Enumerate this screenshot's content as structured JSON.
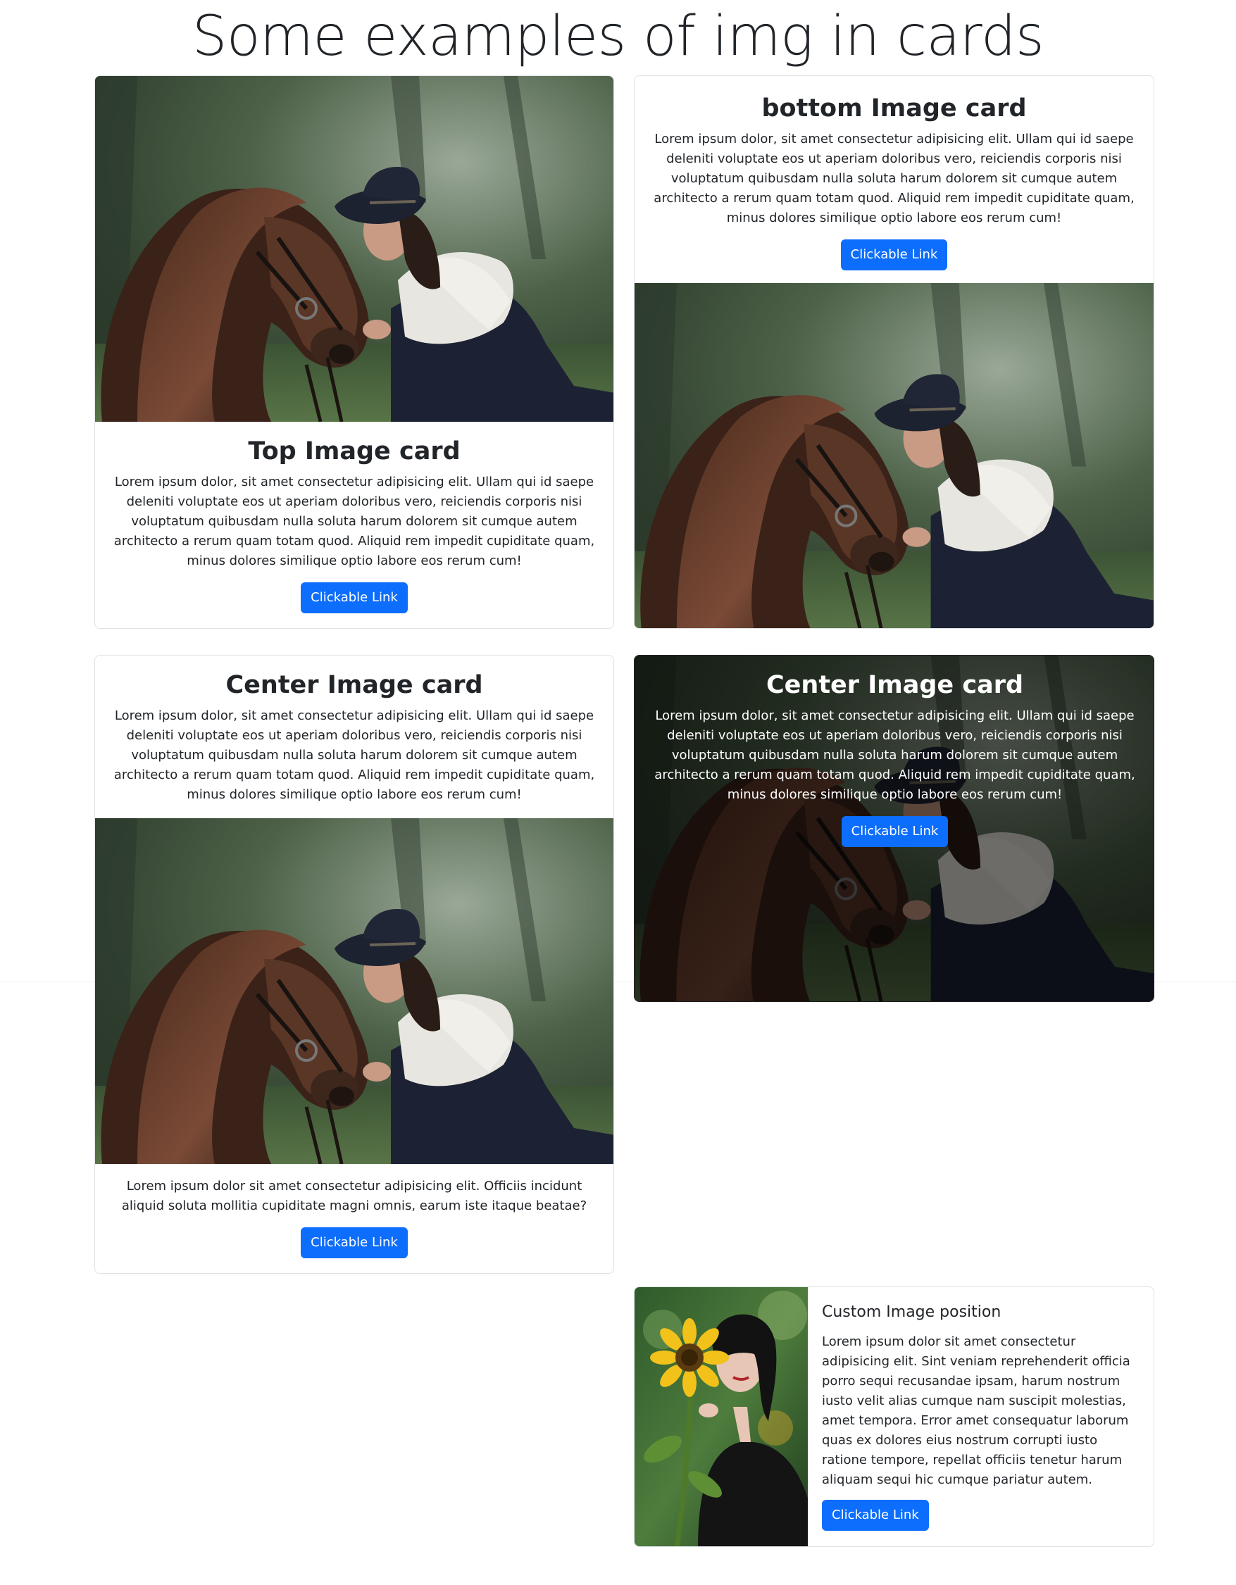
{
  "page": {
    "title": "Some examples of img in cards"
  },
  "cards": {
    "top_image": {
      "title": "Top Image card",
      "text": "Lorem ipsum dolor, sit amet consectetur adipisicing elit. Ullam qui id saepe deleniti voluptate eos ut aperiam doloribus vero, reiciendis corporis nisi voluptatum quibusdam nulla soluta harum dolorem sit cumque autem architecto a rerum quam totam quod. Aliquid rem impedit cupiditate quam, minus dolores similique optio labore eos rerum cum!",
      "button_label": "Clickable Link",
      "image_icon": "horse-photo"
    },
    "bottom_image": {
      "title": "bottom Image card",
      "text": "Lorem ipsum dolor, sit amet consectetur adipisicing elit. Ullam qui id saepe deleniti voluptate eos ut aperiam doloribus vero, reiciendis corporis nisi voluptatum quibusdam nulla soluta harum dolorem sit cumque autem architecto a rerum quam totam quod. Aliquid rem impedit cupiditate quam, minus dolores similique optio labore eos rerum cum!",
      "button_label": "Clickable Link",
      "image_icon": "horse-photo"
    },
    "center_image": {
      "title": "Center Image card",
      "text": "Lorem ipsum dolor, sit amet consectetur adipisicing elit. Ullam qui id saepe deleniti voluptate eos ut aperiam doloribus vero, reiciendis corporis nisi voluptatum quibusdam nulla soluta harum dolorem sit cumque autem architecto a rerum quam totam quod. Aliquid rem impedit cupiditate quam, minus dolores similique optio labore eos rerum cum!",
      "bottom_text": "Lorem ipsum dolor sit amet consectetur adipisicing elit. Officiis incidunt aliquid soluta mollitia cupiditate magni omnis, earum iste itaque beatae?",
      "button_label": "Clickable Link",
      "image_icon": "horse-photo"
    },
    "overlay_image": {
      "title": "Center Image card",
      "text": "Lorem ipsum dolor, sit amet consectetur adipisicing elit. Ullam qui id saepe deleniti voluptate eos ut aperiam doloribus vero, reiciendis corporis nisi voluptatum quibusdam nulla soluta harum dolorem sit cumque autem architecto a rerum quam totam quod. Aliquid rem impedit cupiditate quam, minus dolores similique optio labore eos rerum cum!",
      "button_label": "Clickable Link",
      "image_icon": "horse-photo"
    },
    "custom_position": {
      "title": "Custom Image position",
      "text": "Lorem ipsum dolor sit amet consectetur adipisicing elit. Sint veniam reprehenderit officia porro sequi recusandae ipsam, harum nostrum iusto velit alias cumque nam suscipit molestias, amet tempora. Error amet consequatur laborum quas ex dolores eius nostrum corrupti iusto ratione tempore, repellat officiis tenetur harum aliquam sequi hic cumque pariatur autem.",
      "button_label": "Clickable Link",
      "image_icon": "sunflower-portrait-photo"
    }
  },
  "colors": {
    "primary_button": "#0d6efd",
    "text": "#212529",
    "card_border": "#dee2e6"
  }
}
